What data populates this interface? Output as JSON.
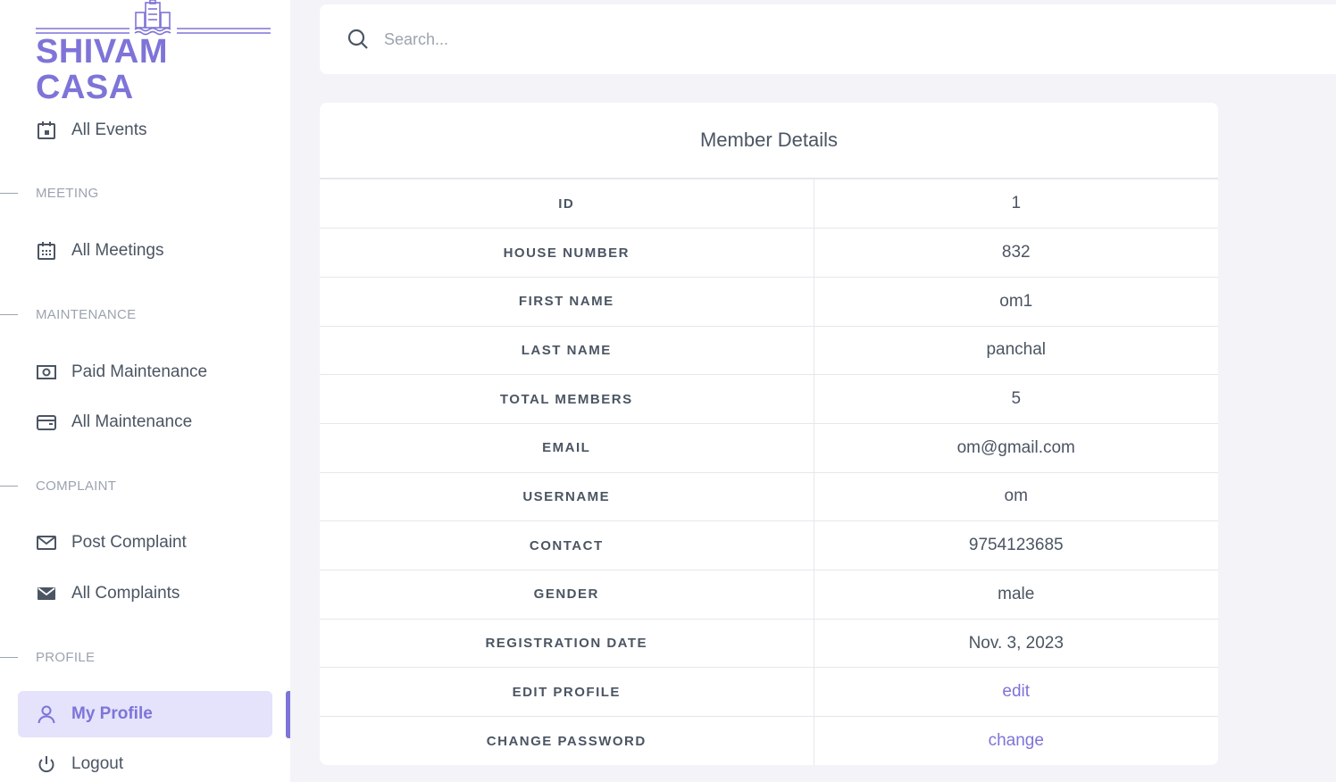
{
  "brand": {
    "name": "SHIVAM CASA",
    "color": "#7e74d8"
  },
  "sidebar": {
    "items": [
      {
        "label": "All Events",
        "icon": "calendar-event-icon"
      },
      {
        "section": "MEETING"
      },
      {
        "label": "All Meetings",
        "icon": "calendar-grid-icon"
      },
      {
        "section": "MAINTENANCE"
      },
      {
        "label": "Paid Maintenance",
        "icon": "cash-icon"
      },
      {
        "label": "All Maintenance",
        "icon": "wallet-icon"
      },
      {
        "section": "COMPLAINT"
      },
      {
        "label": "Post Complaint",
        "icon": "mail-outline-icon"
      },
      {
        "label": "All Complaints",
        "icon": "mail-filled-icon"
      },
      {
        "section": "PROFILE"
      },
      {
        "label": "My Profile",
        "icon": "user-icon",
        "active": true
      },
      {
        "label": "Logout",
        "icon": "power-icon"
      }
    ]
  },
  "search": {
    "placeholder": "Search..."
  },
  "member": {
    "title": "Member Details",
    "rows": [
      {
        "key": "ID",
        "value": "1"
      },
      {
        "key": "HOUSE NUMBER",
        "value": "832"
      },
      {
        "key": "FIRST NAME",
        "value": "om1"
      },
      {
        "key": "LAST NAME",
        "value": "panchal"
      },
      {
        "key": "TOTAL MEMBERS",
        "value": "5"
      },
      {
        "key": "EMAIL",
        "value": "om@gmail.com"
      },
      {
        "key": "USERNAME",
        "value": "om"
      },
      {
        "key": "CONTACT",
        "value": "9754123685"
      },
      {
        "key": "GENDER",
        "value": "male"
      },
      {
        "key": "REGISTRATION DATE",
        "value": "Nov. 3, 2023"
      },
      {
        "key": "EDIT PROFILE",
        "value": "edit",
        "link": true
      },
      {
        "key": "CHANGE PASSWORD",
        "value": "change",
        "link": true
      }
    ]
  }
}
